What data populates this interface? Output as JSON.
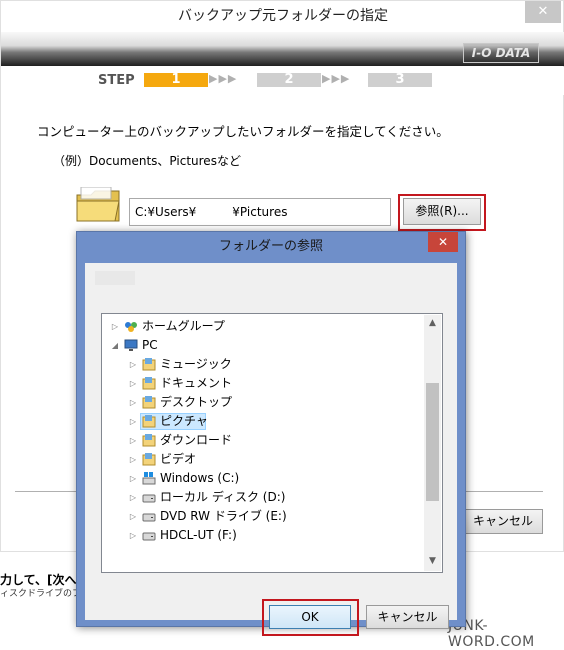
{
  "main_window": {
    "title": "バックアップ元フォルダーの指定",
    "close_glyph": "✕",
    "logo": "I-O DATA",
    "step_label": "STEP",
    "steps": [
      "1",
      "2",
      "3"
    ],
    "step_arrows": "▶▶▶",
    "instruction": "コンピューター上のバックアップしたいフォルダーを指定してください。",
    "example": "（例）Documents、Picturesなど",
    "path_value": "C:¥Users¥　　　¥Pictures",
    "browse_label": "参照(R)...",
    "cancel_label": "キャンセル",
    "colors": {
      "step_active": "#f5a80e",
      "step_inactive": "#cfcfcf",
      "highlight": "#c3171e"
    }
  },
  "background": {
    "text1": "力して、[次へ",
    "text2": "ィスクドライブのフ"
  },
  "watermark": "JUNK-WORD.COM",
  "dialog": {
    "title": "フォルダーの参照",
    "close_glyph": "✕",
    "tree": [
      {
        "label": "ホームグループ",
        "icon": "homegroup-icon",
        "expander": "▷"
      },
      {
        "label": "PC",
        "icon": "pc-icon",
        "expander": "◢"
      },
      {
        "label": "ミュージック",
        "icon": "music-folder-icon",
        "expander": "▷"
      },
      {
        "label": "ドキュメント",
        "icon": "documents-folder-icon",
        "expander": "▷"
      },
      {
        "label": "デスクトップ",
        "icon": "desktop-folder-icon",
        "expander": "▷"
      },
      {
        "label": "ピクチャ",
        "icon": "pictures-folder-icon",
        "expander": "▷",
        "selected": true
      },
      {
        "label": "ダウンロード",
        "icon": "downloads-folder-icon",
        "expander": "▷"
      },
      {
        "label": "ビデオ",
        "icon": "videos-folder-icon",
        "expander": "▷"
      },
      {
        "label": "Windows (C:)",
        "icon": "windows-drive-icon",
        "expander": "▷"
      },
      {
        "label": "ローカル ディスク (D:)",
        "icon": "disk-drive-icon",
        "expander": "▷"
      },
      {
        "label": "DVD RW ドライブ (E:)",
        "icon": "dvd-drive-icon",
        "expander": "▷"
      },
      {
        "label": "HDCL-UT (F:)",
        "icon": "external-drive-icon",
        "expander": "▷"
      }
    ],
    "scroll_up": "▲",
    "scroll_down": "▼",
    "ok_label": "OK",
    "cancel_label": "キャンセル"
  }
}
